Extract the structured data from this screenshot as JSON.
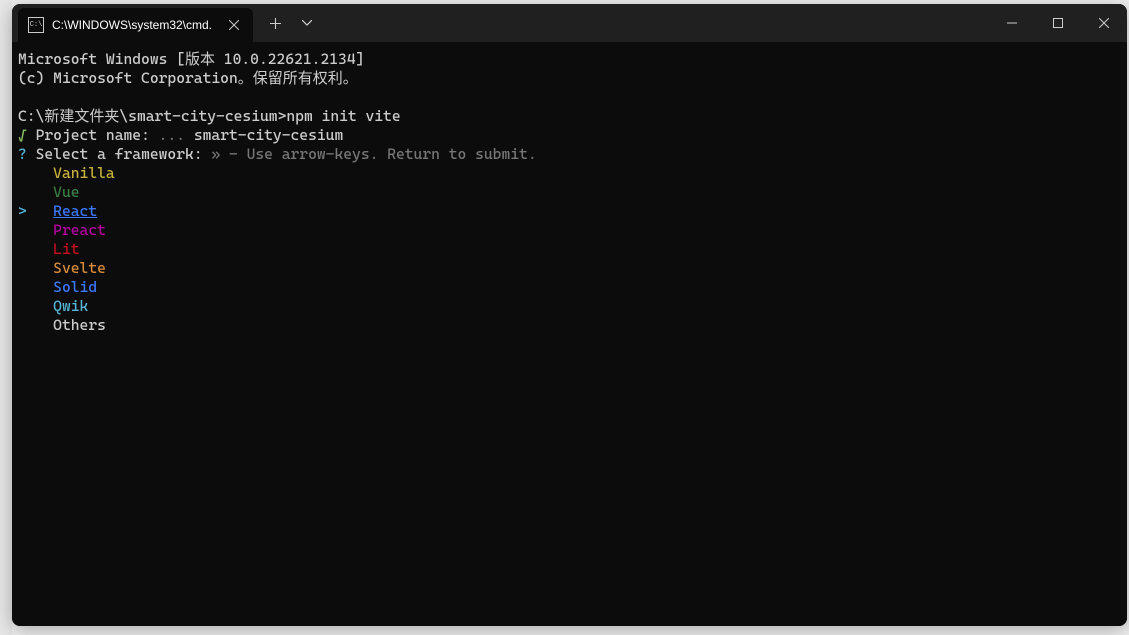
{
  "titlebar": {
    "tab_title": "C:\\WINDOWS\\system32\\cmd.",
    "tab_icon_text": "C:\\"
  },
  "terminal": {
    "line_version": "Microsoft Windows [版本 10.0.22621.2134]",
    "line_copyright": "(c) Microsoft Corporation。保留所有权利。",
    "prompt_path": "C:\\新建文件夹\\smart-city-cesium>",
    "prompt_command": "npm init vite",
    "project_check": "√",
    "project_label": "Project name:",
    "project_ellipsis": "...",
    "project_value": "smart-city-cesium",
    "question_mark": "?",
    "select_label": "Select a framework:",
    "select_hint_arrow": "»",
    "select_hint": "- Use arrow-keys. Return to submit.",
    "cursor": ">",
    "options": {
      "vanilla": "Vanilla",
      "vue": "Vue",
      "react": "React",
      "preact": "Preact",
      "lit": "Lit",
      "svelte": "Svelte",
      "solid": "Solid",
      "qwik": "Qwik",
      "others": "Others"
    }
  }
}
